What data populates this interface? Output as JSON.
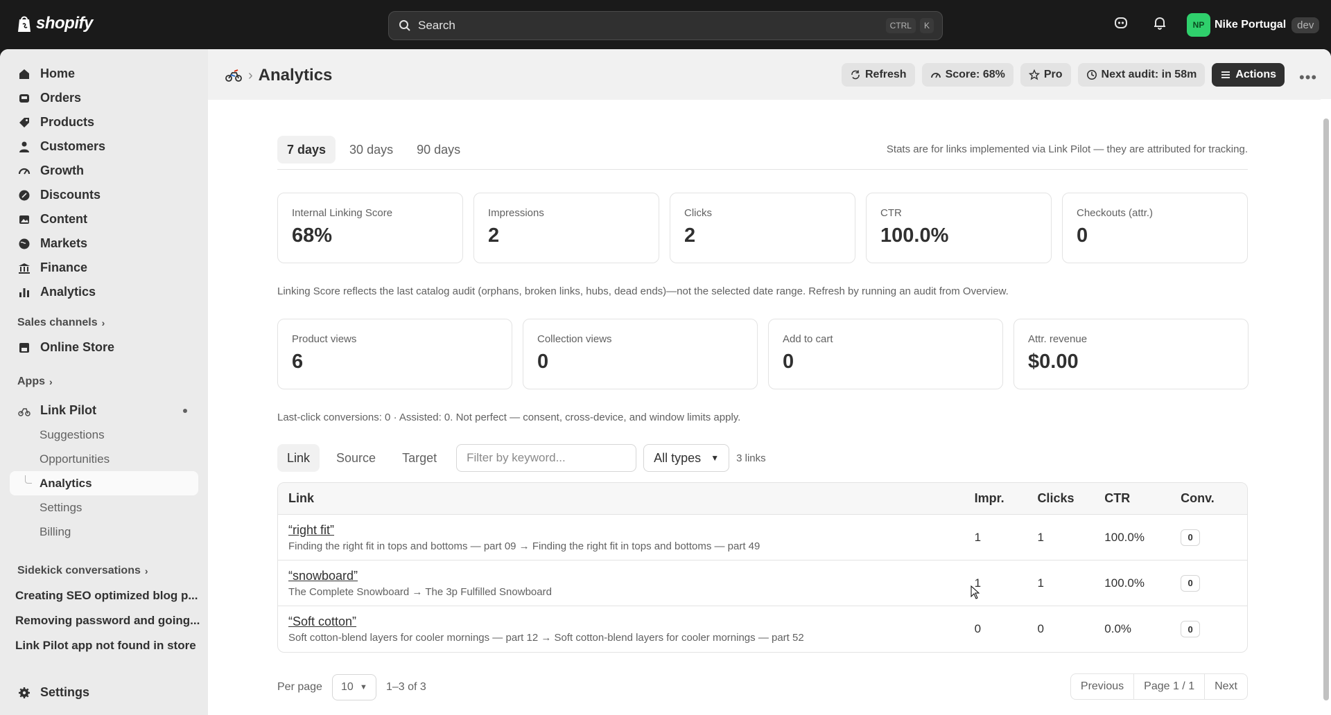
{
  "topbar": {
    "brand": "shopify",
    "search_placeholder": "Search",
    "kbd1": "CTRL",
    "kbd2": "K",
    "avatar_initials": "NP",
    "store_name": "Nike Portugal",
    "env_badge": "dev"
  },
  "sidebar": {
    "items": [
      {
        "label": "Home",
        "icon": "home-icon"
      },
      {
        "label": "Orders",
        "icon": "inbox-icon"
      },
      {
        "label": "Products",
        "icon": "tag-icon"
      },
      {
        "label": "Customers",
        "icon": "person-icon"
      },
      {
        "label": "Growth",
        "icon": "gauge-icon"
      },
      {
        "label": "Discounts",
        "icon": "discount-icon"
      },
      {
        "label": "Content",
        "icon": "image-icon"
      },
      {
        "label": "Markets",
        "icon": "globe-icon"
      },
      {
        "label": "Finance",
        "icon": "bank-icon"
      },
      {
        "label": "Analytics",
        "icon": "bar-chart-icon"
      }
    ],
    "sales_channels": "Sales channels",
    "online_store": "Online Store",
    "apps": "Apps",
    "app_name": "Link Pilot",
    "app_sub": [
      "Suggestions",
      "Opportunities",
      "Analytics",
      "Settings",
      "Billing"
    ],
    "sidekick": "Sidekick conversations",
    "conversations": [
      "Creating SEO optimized blog p...",
      "Removing password and going...",
      "Link Pilot app not found in store"
    ],
    "settings": "Settings"
  },
  "header": {
    "title": "Analytics",
    "refresh": "Refresh",
    "score": "Score: 68%",
    "pro": "Pro",
    "next_audit": "Next audit: in 58m",
    "actions": "Actions"
  },
  "tabs": [
    "7 days",
    "30 days",
    "90 days"
  ],
  "stats_note": "Stats are for links implemented via Link Pilot — they are attributed for tracking.",
  "kpis": [
    {
      "label": "Internal Linking Score",
      "value": "68%"
    },
    {
      "label": "Impressions",
      "value": "2"
    },
    {
      "label": "Clicks",
      "value": "2"
    },
    {
      "label": "CTR",
      "value": "100.0%"
    },
    {
      "label": "Checkouts (attr.)",
      "value": "0"
    }
  ],
  "score_caption": "Linking Score reflects the last catalog audit (orphans, broken links, hubs, dead ends)—not the selected date range. Refresh by running an audit from Overview.",
  "kpis2": [
    {
      "label": "Product views",
      "value": "6"
    },
    {
      "label": "Collection views",
      "value": "0"
    },
    {
      "label": "Add to cart",
      "value": "0"
    },
    {
      "label": "Attr. revenue",
      "value": "$0.00"
    }
  ],
  "conv_caption": "Last-click conversions: 0 · Assisted: 0. Not perfect — consent, cross-device, and window limits apply.",
  "filters": {
    "tabs": [
      "Link",
      "Source",
      "Target"
    ],
    "placeholder": "Filter by keyword...",
    "type": "All types",
    "count": "3 links"
  },
  "table": {
    "headers": [
      "Link",
      "Impr.",
      "Clicks",
      "CTR",
      "Conv."
    ],
    "rows": [
      {
        "anchor": "“right fit”",
        "path": "Finding the right fit in tops and bottoms — part 09 → Finding the right fit in tops and bottoms — part 49",
        "impr": "1",
        "clicks": "1",
        "ctr": "100.0%",
        "conv": "0"
      },
      {
        "anchor": "“snowboard”",
        "path": "The Complete Snowboard → The 3p Fulfilled Snowboard",
        "impr": "1",
        "clicks": "1",
        "ctr": "100.0%",
        "conv": "0"
      },
      {
        "anchor": "“Soft cotton”",
        "path": "Soft cotton-blend layers for cooler mornings — part 12 → Soft cotton-blend layers for cooler mornings — part 52",
        "impr": "0",
        "clicks": "0",
        "ctr": "0.0%",
        "conv": "0"
      }
    ]
  },
  "pager": {
    "per_page": "Per page",
    "size": "10",
    "range": "1–3 of 3",
    "previous": "Previous",
    "page": "Page 1 / 1",
    "next": "Next"
  }
}
